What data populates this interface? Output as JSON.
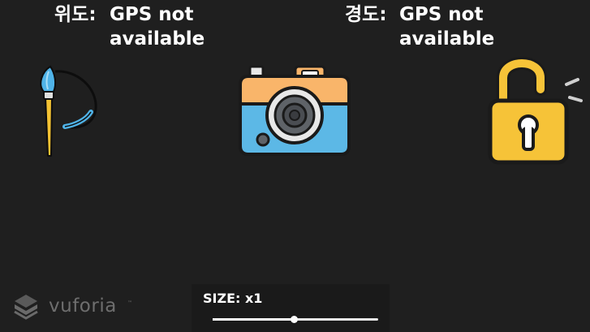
{
  "gps": {
    "latitude_label": "위도:",
    "latitude_value": "GPS not available",
    "longitude_label": "경도:",
    "longitude_value": "GPS not available"
  },
  "tools": {
    "brush_icon": "paintbrush-icon",
    "camera_icon": "camera-icon",
    "lock_icon": "unlocked-padlock-icon"
  },
  "size_control": {
    "label": "SIZE: x1",
    "slider_level": 0.49
  },
  "branding": {
    "wordmark": "vuforia",
    "trademark": "™"
  },
  "colors": {
    "background": "#1f1f1f",
    "brush_blue": "#4fb3e8",
    "brush_yellow": "#f5c333",
    "camera_orange": "#f9b56a",
    "camera_blue": "#5cb8e6",
    "lock_yellow": "#f6c338"
  }
}
